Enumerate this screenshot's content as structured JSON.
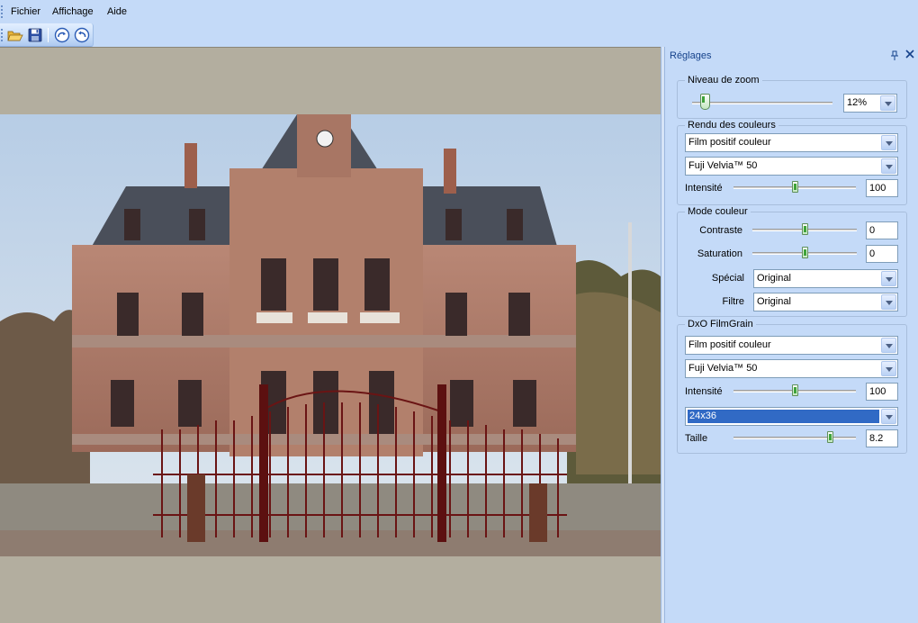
{
  "menu": {
    "items": [
      {
        "label": "Fichier"
      },
      {
        "label": "Affichage"
      },
      {
        "label": "Aide"
      }
    ]
  },
  "toolbar": {
    "icons": [
      "open-folder-icon",
      "save-icon",
      "redo-icon",
      "undo-icon"
    ]
  },
  "panel": {
    "title": "Réglages",
    "zoom": {
      "group_title": "Niveau de zoom",
      "slider_value": 0.12,
      "value": "12%"
    },
    "color_rendering": {
      "group_title": "Rendu des couleurs",
      "category": "Film positif couleur",
      "film": "Fuji Velvia™ 50",
      "intensity_label": "Intensité",
      "intensity_value": "100"
    },
    "color_mode": {
      "group_title": "Mode couleur",
      "contrast_label": "Contraste",
      "contrast_value": "0",
      "saturation_label": "Saturation",
      "saturation_value": "0",
      "special_label": "Spécial",
      "special_value": "Original",
      "filter_label": "Filtre",
      "filter_value": "Original"
    },
    "film_grain": {
      "group_title": "DxO FilmGrain",
      "category": "Film positif couleur",
      "film": "Fuji Velvia™ 50",
      "intensity_label": "Intensité",
      "intensity_value": "100",
      "format_value": "24x36",
      "size_label": "Taille",
      "size_value": "8.2"
    }
  },
  "colors": {
    "chrome_blue": "#c4daf8",
    "viewer_background": "#b3ae9f",
    "selection": "#316ac5"
  }
}
